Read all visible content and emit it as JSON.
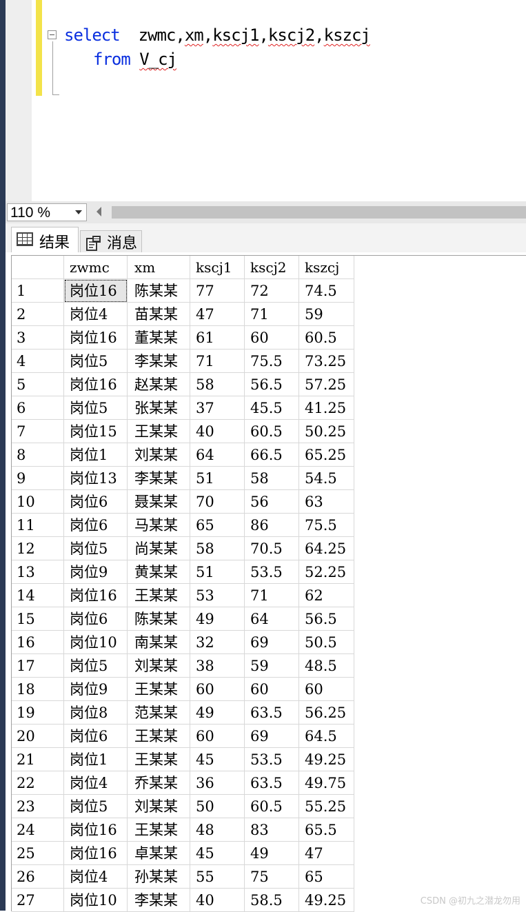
{
  "editor": {
    "line1": {
      "keyword": "select",
      "columns": [
        "zwmc",
        "xm",
        "kscj1",
        "kscj2",
        "kszcj"
      ],
      "separator": ","
    },
    "line2": {
      "keyword": "from",
      "table": "V_cj"
    }
  },
  "toolbar": {
    "zoom": "110 %"
  },
  "tabs": {
    "results": "结果",
    "messages": "消息"
  },
  "grid": {
    "columns": [
      "",
      "zwmc",
      "xm",
      "kscj1",
      "kscj2",
      "kszcj"
    ],
    "rows": [
      [
        "1",
        "岗位16",
        "陈某某",
        "77",
        "72",
        "74.5"
      ],
      [
        "2",
        "岗位4",
        "苗某某",
        "47",
        "71",
        "59"
      ],
      [
        "3",
        "岗位16",
        "董某某",
        "61",
        "60",
        "60.5"
      ],
      [
        "4",
        "岗位5",
        "李某某",
        "71",
        "75.5",
        "73.25"
      ],
      [
        "5",
        "岗位16",
        "赵某某",
        "58",
        "56.5",
        "57.25"
      ],
      [
        "6",
        "岗位5",
        "张某某",
        "37",
        "45.5",
        "41.25"
      ],
      [
        "7",
        "岗位15",
        "王某某",
        "40",
        "60.5",
        "50.25"
      ],
      [
        "8",
        "岗位1",
        "刘某某",
        "64",
        "66.5",
        "65.25"
      ],
      [
        "9",
        "岗位13",
        "李某某",
        "51",
        "58",
        "54.5"
      ],
      [
        "10",
        "岗位6",
        "聂某某",
        "70",
        "56",
        "63"
      ],
      [
        "11",
        "岗位6",
        "马某某",
        "65",
        "86",
        "75.5"
      ],
      [
        "12",
        "岗位5",
        "尚某某",
        "58",
        "70.5",
        "64.25"
      ],
      [
        "13",
        "岗位9",
        "黄某某",
        "51",
        "53.5",
        "52.25"
      ],
      [
        "14",
        "岗位16",
        "王某某",
        "53",
        "71",
        "62"
      ],
      [
        "15",
        "岗位6",
        "陈某某",
        "49",
        "64",
        "56.5"
      ],
      [
        "16",
        "岗位10",
        "南某某",
        "32",
        "69",
        "50.5"
      ],
      [
        "17",
        "岗位5",
        "刘某某",
        "38",
        "59",
        "48.5"
      ],
      [
        "18",
        "岗位9",
        "王某某",
        "60",
        "60",
        "60"
      ],
      [
        "19",
        "岗位8",
        "范某某",
        "49",
        "63.5",
        "56.25"
      ],
      [
        "20",
        "岗位6",
        "王某某",
        "60",
        "69",
        "64.5"
      ],
      [
        "21",
        "岗位1",
        "王某某",
        "45",
        "53.5",
        "49.25"
      ],
      [
        "22",
        "岗位4",
        "乔某某",
        "36",
        "63.5",
        "49.75"
      ],
      [
        "23",
        "岗位5",
        "刘某某",
        "50",
        "60.5",
        "55.25"
      ],
      [
        "24",
        "岗位16",
        "王某某",
        "48",
        "83",
        "65.5"
      ],
      [
        "25",
        "岗位16",
        "卓某某",
        "45",
        "49",
        "47"
      ],
      [
        "26",
        "岗位4",
        "孙某某",
        "55",
        "75",
        "65"
      ],
      [
        "27",
        "岗位10",
        "李某某",
        "40",
        "58.5",
        "49.25"
      ]
    ]
  },
  "watermark": "CSDN @初九之潜龙勿用"
}
